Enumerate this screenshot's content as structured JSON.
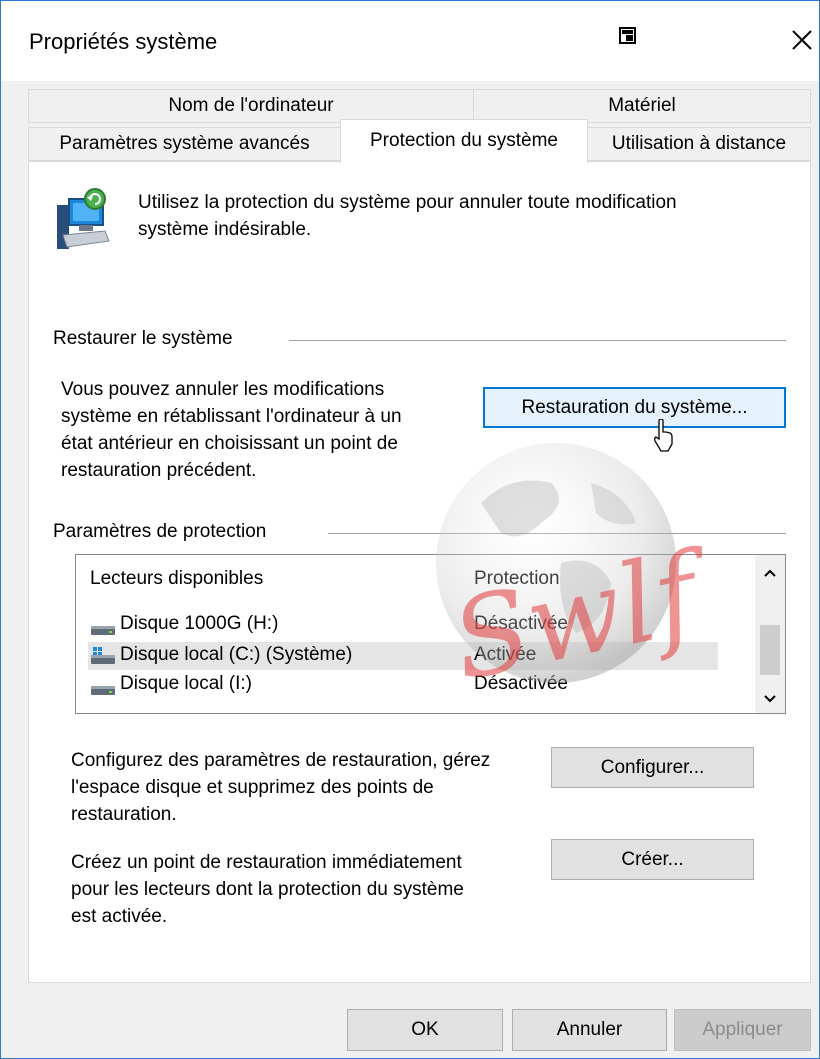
{
  "window": {
    "title": "Propriétés système"
  },
  "tabs_row1": [
    "Nom de l'ordinateur",
    "Matériel"
  ],
  "tabs_row2": [
    "Paramètres système avancés",
    "Protection du système",
    "Utilisation à distance"
  ],
  "active_tab": "Protection du système",
  "intro": {
    "text_line1": "Utilisez la protection du système pour annuler toute modification",
    "text_line2": "système indésirable."
  },
  "restore_section": {
    "heading": "Restaurer le système",
    "description_lines": [
      "Vous pouvez annuler les modifications",
      "système en rétablissant l'ordinateur à un",
      "état antérieur en choisissant un point de",
      "restauration précédent."
    ],
    "button_label": "Restauration du système..."
  },
  "protection_section": {
    "heading": "Paramètres de protection",
    "columns": [
      "Lecteurs disponibles",
      "Protection"
    ],
    "rows": [
      {
        "drive": "Disque 1000G (H:)",
        "status": "Désactivée"
      },
      {
        "drive": "Disque local (C:) (Système)",
        "status": "Activée"
      },
      {
        "drive": "Disque local (I:)",
        "status": "Désactivée"
      }
    ],
    "configure_lines": [
      "Configurez des paramètres de restauration, gérez",
      "l'espace disque et supprimez des points de",
      "restauration."
    ],
    "configure_button": "Configurer...",
    "create_lines": [
      "Créez un point de restauration immédiatement",
      "pour les lecteurs dont la protection du système",
      "est activée."
    ],
    "create_button": "Créer..."
  },
  "footer": {
    "ok": "OK",
    "cancel": "Annuler",
    "apply": "Appliquer"
  },
  "watermark_text": "Swlf",
  "colors": {
    "accent": "#0078d7",
    "window_border": "#2b79d0",
    "watermark": "#e23c3c"
  }
}
